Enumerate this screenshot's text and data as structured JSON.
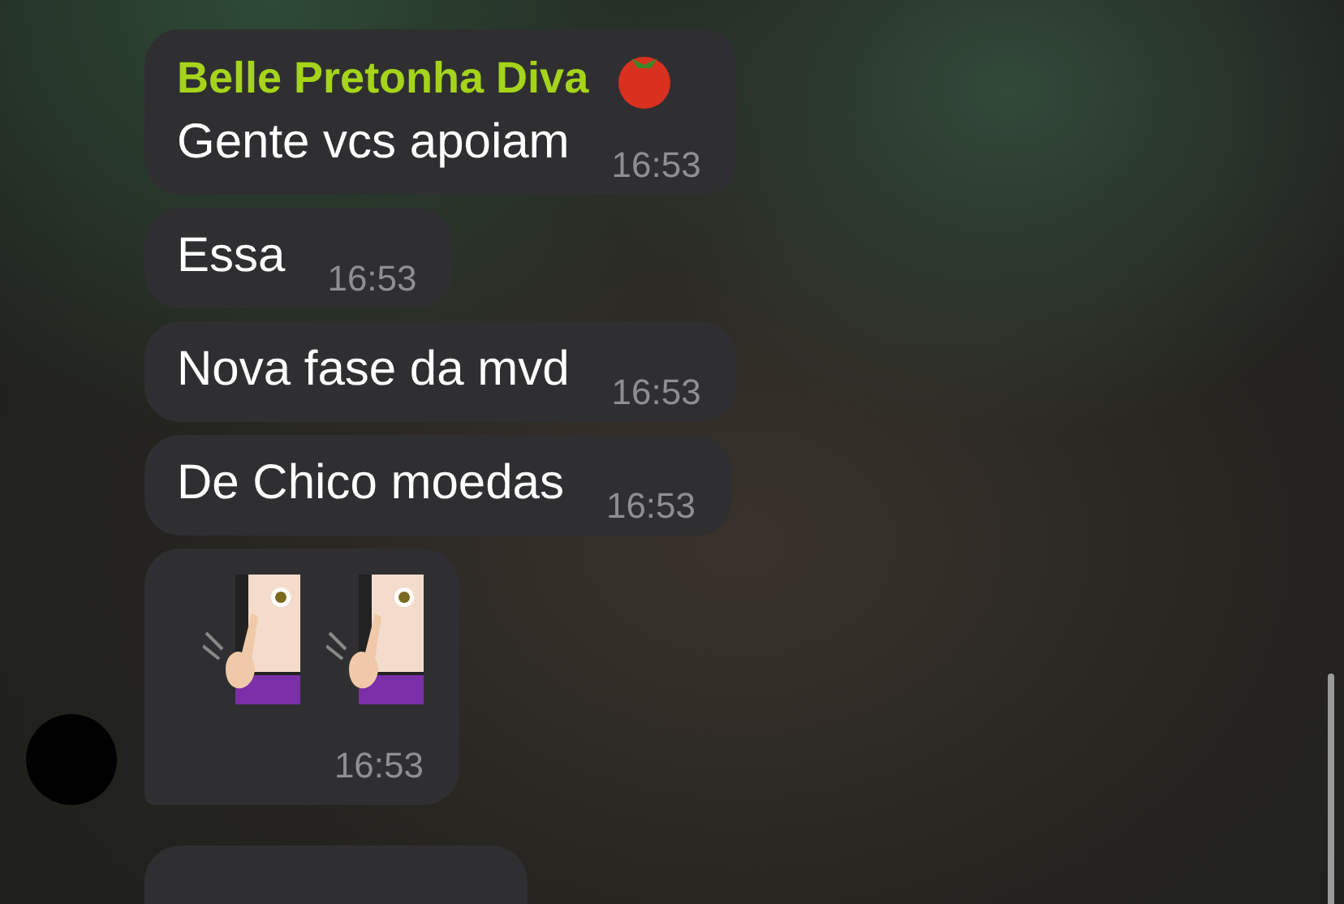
{
  "messages": [
    {
      "kind": "text",
      "sender": "Belle Pretonha Diva",
      "text": "Gente vcs apoiam",
      "time": "16:53"
    },
    {
      "kind": "text",
      "text": "Essa",
      "time": "16:53"
    },
    {
      "kind": "text",
      "text": "Nova fase da mvd",
      "time": "16:53"
    },
    {
      "kind": "text",
      "text": "De Chico moedas",
      "time": "16:53"
    },
    {
      "kind": "emoji",
      "time": "16:53"
    },
    {
      "kind": "cut_off"
    }
  ]
}
